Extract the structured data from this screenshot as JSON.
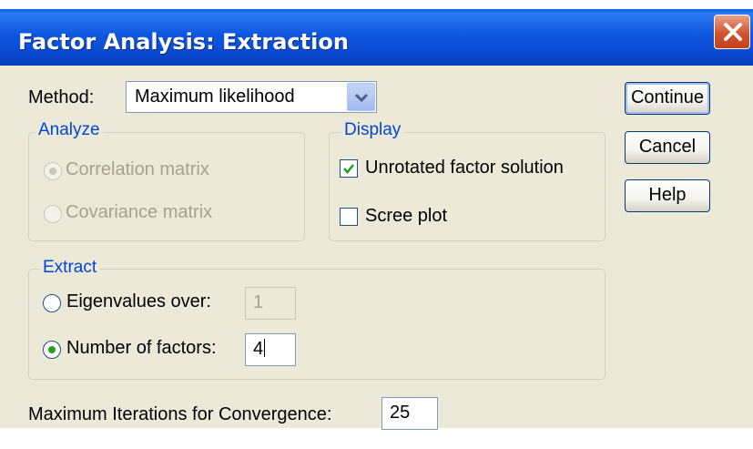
{
  "window": {
    "title": "Factor Analysis: Extraction"
  },
  "method": {
    "label": "Method:",
    "selected": "Maximum likelihood"
  },
  "analyze": {
    "legend": "Analyze",
    "options": [
      {
        "label": "Correlation matrix",
        "selected": true,
        "enabled": false
      },
      {
        "label": "Covariance matrix",
        "selected": false,
        "enabled": false
      }
    ]
  },
  "display": {
    "legend": "Display",
    "unrotated": {
      "label": "Unrotated factor solution",
      "checked": true
    },
    "scree": {
      "label": "Scree plot",
      "checked": false
    }
  },
  "extract": {
    "legend": "Extract",
    "eigen": {
      "label": "Eigenvalues over:",
      "value": "1",
      "selected": false,
      "enabled": false
    },
    "factors": {
      "label": "Number of factors:",
      "value": "4",
      "selected": true
    }
  },
  "iterations": {
    "label": "Maximum Iterations for Convergence:",
    "value": "25"
  },
  "buttons": {
    "continue": "Continue",
    "cancel": "Cancel",
    "help": "Help"
  }
}
